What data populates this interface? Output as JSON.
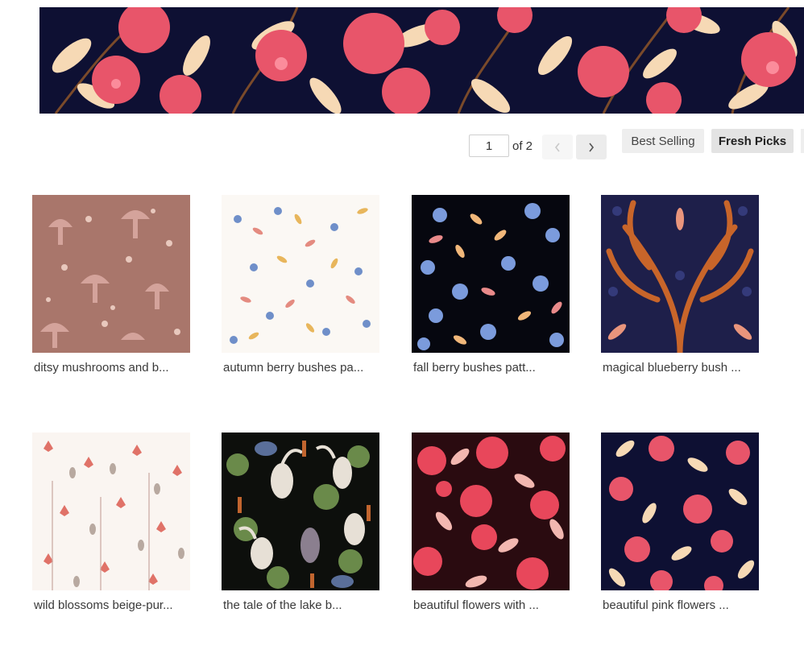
{
  "pagination": {
    "current_page": "1",
    "of_label": "of 2"
  },
  "sort": {
    "best_selling": "Best Selling",
    "fresh_picks": "Fresh Picks"
  },
  "icons": {
    "prev": "chevron-left-icon",
    "next": "chevron-right-icon"
  },
  "colors": {
    "banner_bg": "#0e1033",
    "accent_pink": "#e8556a",
    "accent_cream": "#f6d9b5"
  },
  "products": [
    {
      "title": "ditsy mushrooms and b..."
    },
    {
      "title": "autumn berry bushes pa..."
    },
    {
      "title": "fall berry bushes patt..."
    },
    {
      "title": "magical blueberry bush ..."
    },
    {
      "title": "wild blossoms beige-pur..."
    },
    {
      "title": "the tale of the lake b..."
    },
    {
      "title": "beautiful flowers with ..."
    },
    {
      "title": "beautiful pink flowers ..."
    }
  ]
}
